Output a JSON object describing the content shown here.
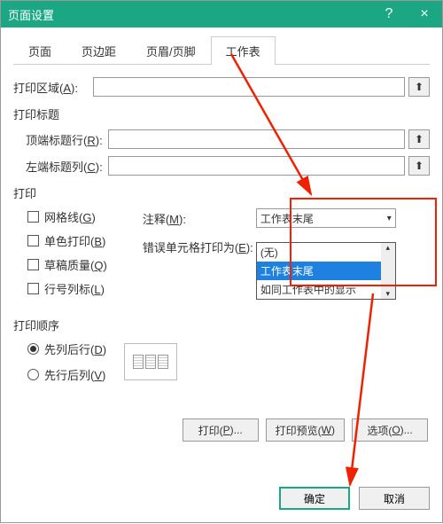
{
  "titlebar": {
    "title": "页面设置",
    "help": "?",
    "close": "×"
  },
  "tabs": {
    "t0": "页面",
    "t1": "页边距",
    "t2": "页眉/页脚",
    "t3": "工作表"
  },
  "area": {
    "label": "打印区域(",
    "hot": "A",
    "suffix": "):"
  },
  "titles": {
    "group": "打印标题",
    "top_label": "顶端标题行(",
    "top_hot": "R",
    "top_suffix": "):",
    "left_label": "左端标题列(",
    "left_hot": "C",
    "left_suffix": "):"
  },
  "print": {
    "group": "打印",
    "grid": "网格线(",
    "grid_hot": "G",
    "grid_suf": ")",
    "mono": "单色打印(",
    "mono_hot": "B",
    "mono_suf": ")",
    "draft": "草稿质量(",
    "draft_hot": "Q",
    "draft_suf": ")",
    "head": "行号列标(",
    "head_hot": "L",
    "head_suf": ")",
    "comments_label": "注释(",
    "comments_hot": "M",
    "comments_suf": "):",
    "comments_value": "工作表末尾",
    "errors_label": "错误单元格打印为(",
    "errors_hot": "E",
    "errors_suf": "):",
    "opt_none": "(无)",
    "opt_end": "工作表末尾",
    "opt_as": "如同工作表中的显示"
  },
  "order": {
    "group": "打印顺序",
    "dtr": "先列后行(",
    "dtr_hot": "D",
    "dtr_suf": ")",
    "otd": "先行后列(",
    "otd_hot": "V",
    "otd_suf": ")"
  },
  "buttons": {
    "print": "打印(",
    "print_hot": "P",
    "print_suf": ")...",
    "preview": "打印预览(",
    "preview_hot": "W",
    "preview_suf": ")",
    "options": "选项(",
    "options_hot": "O",
    "options_suf": ")...",
    "ok": "确定",
    "cancel": "取消"
  },
  "icons": {
    "picker": "⬆"
  }
}
